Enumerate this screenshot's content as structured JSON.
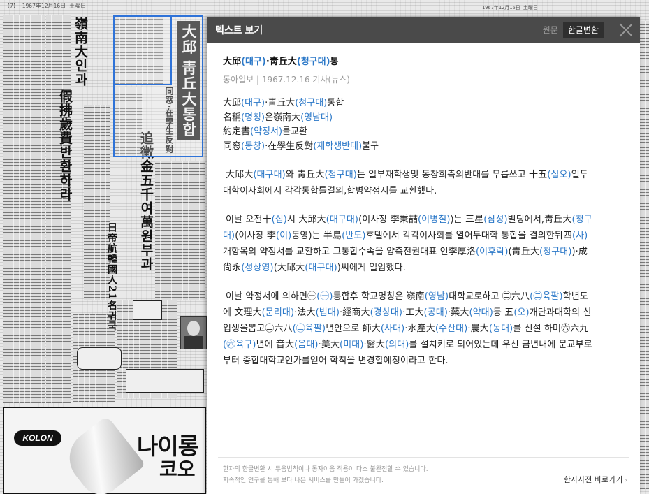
{
  "newspaper": {
    "masthead": "【7】 1967年12月16日 土曜日",
    "masthead_right": "1967年12月16日 土曜日",
    "headlines": {
      "h1": "嶺南大인과",
      "h2": "假拂歲費반환하라",
      "h3": "追徵金五千여萬원부과",
      "h4": "日帝航韓國人21名귀국",
      "h5": "大邱 靑丘大통합",
      "h6": "同窓·在學生反對"
    },
    "ad": {
      "brand": "KOLON",
      "title": "나이롱",
      "subtitle": "코오"
    }
  },
  "viewer": {
    "title": "텍스트 보기",
    "tabs": [
      {
        "label": "원문",
        "active": false
      },
      {
        "label": "한글변환",
        "active": true
      }
    ],
    "article": {
      "title_html": "大邱<span class=\"k\">(대구)</span>·靑丘大<span class=\"k\">(청구대)</span>통",
      "meta": "동아일보 | 1967.12.16 기사(뉴스)",
      "sublines_html": [
        "大邱<span class=\"k\">(대구)</span>·靑丘大<span class=\"k\">(청구대)</span>통합",
        "名稱<span class=\"k\">(명칭)</span>은嶺南大<span class=\"k\">(영남대)</span>",
        "約定書<span class=\"k\">(약정서)</span>를교환",
        "同窓<span class=\"k\">(동창)</span>·在學生反對<span class=\"k\">(재학생반대)</span>불구"
      ],
      "paragraphs_html": [
        "大邱大<span class=\"k\">(대구대)</span>와 靑丘大<span class=\"k\">(청구대)</span>는 일부재학생및 동창회측의반대를 무릅쓰고 十五<span class=\"k\">(십오)</span>일두대학이사회에서 각각통합를결의,합병약정서를 교환했다.",
        "이날 오전十<span class=\"k\">(십)</span>시 大邱大<span class=\"k\">(대구대)</span>(이사장 李秉喆<span class=\"k\">(이병철)</span>)는 三星<span class=\"k\">(삼성)</span>빌딩에서,靑丘大<span class=\"k\">(청구대)</span>(이사장 李<span class=\"k\">(이)</span>동영)는 半島<span class=\"k\">(반도)</span>호텔에서 각각이사회를 열어두대학 통합을 결의한뒤四<span class=\"k\">(사)</span>개항목의 약정서를 교환하고 그통합수속을 양측전권대표 인李厚洛<span class=\"k\">(이후락)</span>(靑丘大<span class=\"k\">(청구대)</span>)·成尙永<span class=\"k\">(성상영)</span>(大邱大<span class=\"k\">(대구대)</span>)씨에게 일임했다.",
        "이날 약정서에 의하면㊀<span class=\"k\">(㊀)</span>통합후 학교명칭은 嶺南<span class=\"k\">(영남)</span>대학교로하고 ㊁六八<span class=\"k\">(㊁육팔)</span>학년도에 文理大<span class=\"k\">(문리대)</span>·法大<span class=\"k\">(법대)</span>·經商大<span class=\"k\">(경상대)</span>·工大<span class=\"k\">(공대)</span>·藥大<span class=\"k\">(약대)</span>등 五<span class=\"k\">(오)</span>개단과대학의 신입생을뽑고㊁六八<span class=\"k\">(㊁육팔)</span>년안으로 師大<span class=\"k\">(사대)</span>·水產大<span class=\"k\">(수산대)</span>·農大<span class=\"k\">(농대)</span>를 신설 하며㊅六九<span class=\"k\">(㊅육구)</span>년에 音大<span class=\"k\">(음대)</span>·美大<span class=\"k\">(미대)</span>·醫大<span class=\"k\">(의대)</span>를 설치키로 되어있는데 우선 금년내에 문교부로부터 종합대학교인가를얻어 학칙을 변경할예정이라고 한다."
      ]
    },
    "notice": [
      "한자의 한글변환 시 두음법칙이나 동자이음 적용이 다소 불완전할 수 있습니다.",
      "지속적인 연구를 통해 보다 나은 서비스를 만들어 가겠습니다."
    ],
    "dictionary_link": "한자사전 바로가기",
    "dictionary_arrow": "›"
  }
}
